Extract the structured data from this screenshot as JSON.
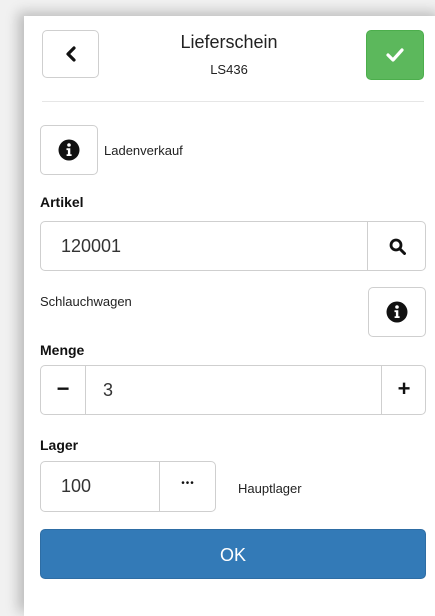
{
  "header": {
    "title": "Lieferschein",
    "subtitle": "LS436"
  },
  "customer": {
    "name": "Ladenverkauf"
  },
  "artikel": {
    "label": "Artikel",
    "value": "120001",
    "description": "Schlauchwagen"
  },
  "menge": {
    "label": "Menge",
    "value": "3",
    "minus": "−",
    "plus": "+"
  },
  "lager": {
    "label": "Lager",
    "value": "100",
    "browse": "•••",
    "name": "Hauptlager"
  },
  "actions": {
    "ok_label": "OK"
  },
  "colors": {
    "confirm": "#5cb85c",
    "primary": "#337ab7"
  },
  "icons": {
    "back": "chevron-left-icon",
    "confirm": "check-icon",
    "info": "info-icon",
    "search": "search-icon"
  }
}
